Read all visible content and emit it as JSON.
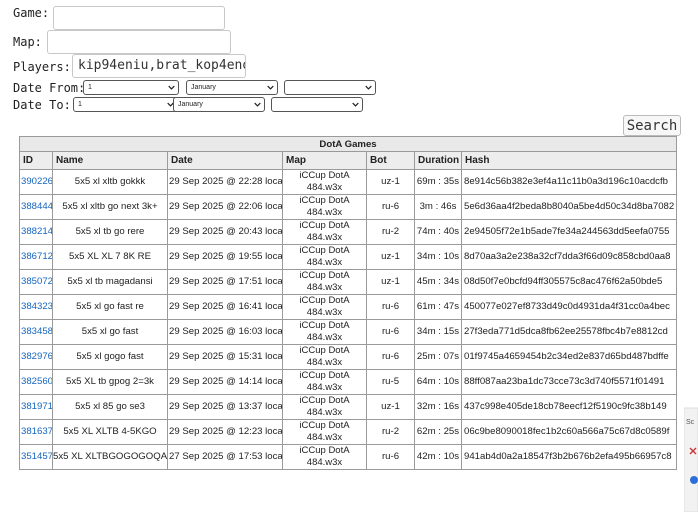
{
  "form": {
    "game_label": "Game:",
    "game_value": "",
    "map_label": "Map:",
    "map_value": "",
    "players_label": "Players:",
    "players_value": "kip94eniu,brat_kop4enogo",
    "date_from_label": "Date From:",
    "date_to_label": "Date To:",
    "from_day": "1",
    "from_month": "January",
    "from_year": "",
    "to_day": "1",
    "to_month": "January",
    "to_year": "",
    "search_label": "Search"
  },
  "table": {
    "caption": "DotA Games",
    "headers": [
      "ID",
      "Name",
      "Date",
      "Map",
      "Bot",
      "Duration",
      "Hash"
    ],
    "rows": [
      [
        "390226",
        "5x5 xl xltb gokkk",
        "29 Sep 2025 @ 22:28 local",
        "iCCup DotA 484.w3x",
        "uz-1",
        "69m : 35s",
        "8e914c56b382e3ef4a11c11b0a3d196c10acdcfb"
      ],
      [
        "388444",
        "5x5 xl xltb go next 3k+",
        "29 Sep 2025 @ 22:06 local",
        "iCCup DotA 484.w3x",
        "ru-6",
        "3m : 46s",
        "5e6d36aa4f2beda8b8040a5be4d50c34d8ba7082"
      ],
      [
        "388214",
        "5x5 xl tb go rere",
        "29 Sep 2025 @ 20:43 local",
        "iCCup DotA 484.w3x",
        "ru-2",
        "74m : 40s",
        "2e94505f72e1b5ade7fe34a244563dd5eefa0755"
      ],
      [
        "386712",
        "5x5 XL XL 7 8K RE",
        "29 Sep 2025 @ 19:55 local",
        "iCCup DotA 484.w3x",
        "uz-1",
        "34m : 10s",
        "8d70aa3a2e238a32cf7dda3f66d09c858cbd0aa8"
      ],
      [
        "385072",
        "5x5 xl tb magadansi",
        "29 Sep 2025 @ 17:51 local",
        "iCCup DotA 484.w3x",
        "uz-1",
        "45m : 34s",
        "08d50f7e0bcfd94ff305575c8ac476f62a50bde5"
      ],
      [
        "384323",
        "5x5 xl go fast re",
        "29 Sep 2025 @ 16:41 local",
        "iCCup DotA 484.w3x",
        "ru-6",
        "61m : 47s",
        "450077e027ef8733d49c0d4931da4f31cc0a4bec"
      ],
      [
        "383458",
        "5x5 xl go fast",
        "29 Sep 2025 @ 16:03 local",
        "iCCup DotA 484.w3x",
        "ru-6",
        "34m : 15s",
        "27f3eda771d5dca8fb62ee25578fbc4b7e8812cd"
      ],
      [
        "382976",
        "5x5 xl gogo fast",
        "29 Sep 2025 @ 15:31 local",
        "iCCup DotA 484.w3x",
        "ru-6",
        "25m : 07s",
        "01f9745a4659454b2c34ed2e837d65bd487bdffe"
      ],
      [
        "382560",
        "5x5 XL tb gpog 2=3k",
        "29 Sep 2025 @ 14:14 local",
        "iCCup DotA 484.w3x",
        "ru-5",
        "64m : 10s",
        "88ff087aa23ba1dc73cce73c3d740f5571f01491"
      ],
      [
        "381971",
        "5x5 xl 85 go se3",
        "29 Sep 2025 @ 13:37 local",
        "iCCup DotA 484.w3x",
        "uz-1",
        "32m : 16s",
        "437c998e405de18cb78eecf12f5190c9fc38b149"
      ],
      [
        "381637",
        "5x5 XL XLTB 4-5KGO",
        "29 Sep 2025 @ 12:23 local",
        "iCCup DotA 484.w3x",
        "ru-2",
        "62m : 25s",
        "06c9be8090018fec1b2c60a566a75c67d8c0589f"
      ],
      [
        "351457",
        "5x5 XL XLTBGOGOGOQA",
        "27 Sep 2025 @ 17:53 local",
        "iCCup DotA 484.w3x",
        "ru-6",
        "42m : 10s",
        "941ab4d0a2a18547f3b2b676b2efa495b66957c8"
      ]
    ]
  },
  "colors": {
    "link": "#1565c0",
    "header_bg": "#ededed",
    "border": "#9a9a9a"
  }
}
